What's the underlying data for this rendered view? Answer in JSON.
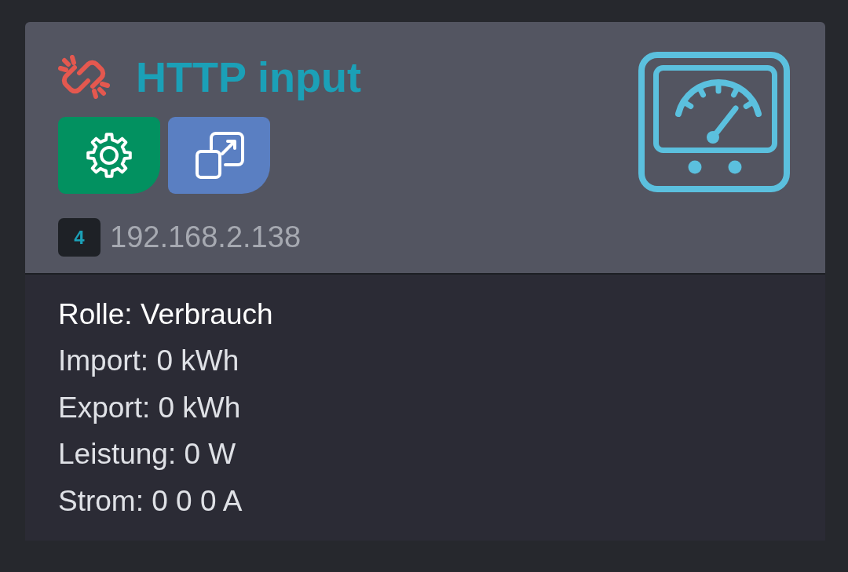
{
  "card": {
    "connected": false,
    "title": "HTTP input",
    "buttons": [
      {
        "kind": "settings"
      },
      {
        "kind": "popout"
      }
    ],
    "badge": "4",
    "address": "192.168.2.138",
    "role": "Rolle: Verbrauch",
    "readings": [
      "Import: 0 kWh",
      "Export: 0 kWh",
      "Leistung: 0 W",
      "Strom: 0 0 0 A"
    ]
  }
}
